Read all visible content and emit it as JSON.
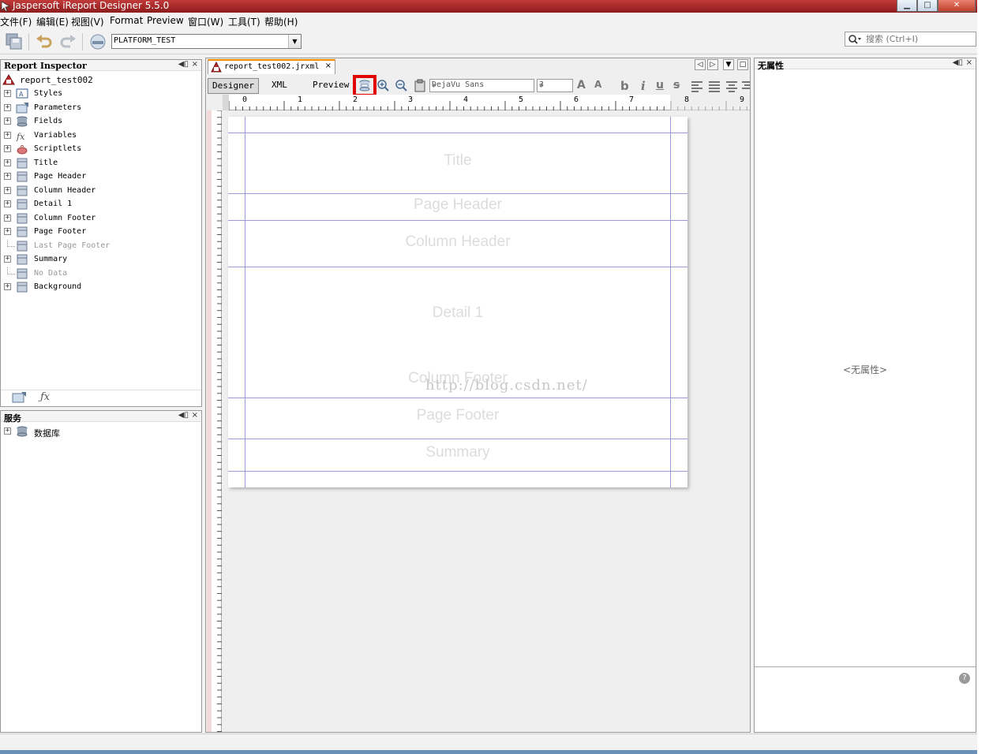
{
  "window": {
    "title": "Jaspersoft iReport Designer 5.5.0",
    "controls": {
      "minimize": "▁",
      "maximize": "□",
      "close": "✕"
    }
  },
  "menu": [
    "文件(F)",
    "编辑(E)",
    "视图(V)",
    "Format",
    "Preview",
    "窗口(W)",
    "工具(T)",
    "帮助(H)"
  ],
  "toolbar": {
    "connection": "PLATFORM_TEST",
    "search_placeholder": "搜索 (Ctrl+I)"
  },
  "inspector": {
    "title": "Report Inspector",
    "root": "report_test002",
    "items": [
      {
        "label": "Styles",
        "icon": "styles-icon",
        "expandable": true,
        "enabled": true
      },
      {
        "label": "Parameters",
        "icon": "parameters-icon",
        "expandable": true,
        "enabled": true
      },
      {
        "label": "Fields",
        "icon": "fields-icon",
        "expandable": true,
        "enabled": true
      },
      {
        "label": "Variables",
        "icon": "variables-icon",
        "expandable": true,
        "enabled": true
      },
      {
        "label": "Scriptlets",
        "icon": "scriptlets-icon",
        "expandable": true,
        "enabled": true
      },
      {
        "label": "Title",
        "icon": "band-icon",
        "expandable": true,
        "enabled": true
      },
      {
        "label": "Page Header",
        "icon": "band-icon",
        "expandable": true,
        "enabled": true
      },
      {
        "label": "Column Header",
        "icon": "band-icon",
        "expandable": true,
        "enabled": true
      },
      {
        "label": "Detail 1",
        "icon": "band-icon",
        "expandable": true,
        "enabled": true
      },
      {
        "label": "Column Footer",
        "icon": "band-icon",
        "expandable": true,
        "enabled": true
      },
      {
        "label": "Page Footer",
        "icon": "band-icon",
        "expandable": true,
        "enabled": true
      },
      {
        "label": "Last Page Footer",
        "icon": "band-icon",
        "expandable": false,
        "enabled": false
      },
      {
        "label": "Summary",
        "icon": "band-icon",
        "expandable": true,
        "enabled": true
      },
      {
        "label": "No Data",
        "icon": "band-icon",
        "expandable": false,
        "enabled": false
      },
      {
        "label": "Background",
        "icon": "band-icon",
        "expandable": true,
        "enabled": true
      }
    ],
    "controls": {
      "minimize": "◀▯",
      "close": "×"
    }
  },
  "services": {
    "title": "服务",
    "items": [
      {
        "label": "数据库",
        "icon": "database-icon"
      }
    ]
  },
  "editor": {
    "tab_name": "report_test002.jrxml",
    "tab_close": "×",
    "views": [
      "Designer",
      "XML",
      "Preview"
    ],
    "font_name": "DejaVu Sans",
    "font_size": "3",
    "ruler_numbers": [
      "0",
      "1",
      "2",
      "3",
      "4",
      "5",
      "6",
      "7",
      "8",
      "9"
    ],
    "bands": [
      "Title",
      "Page Header",
      "Column Header",
      "Detail 1",
      "Column Footer",
      "Page Footer",
      "Summary"
    ],
    "watermark": "http://blog.csdn.net/"
  },
  "properties": {
    "title": "无属性",
    "empty_text": "<无属性>",
    "help": "?"
  }
}
